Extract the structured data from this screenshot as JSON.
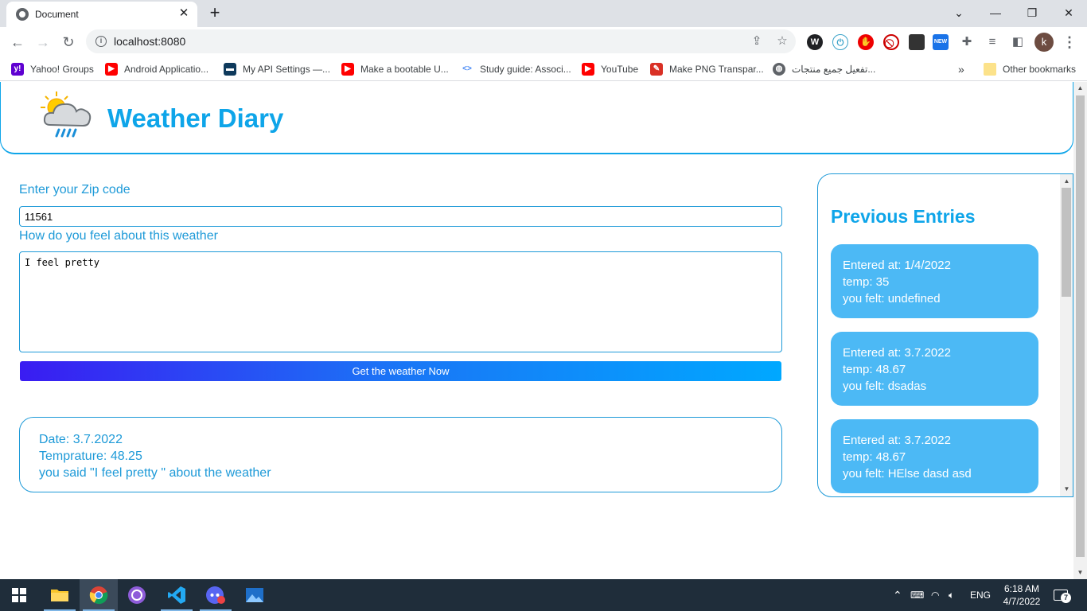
{
  "browser": {
    "tab_title": "Document",
    "tab_close": "✕",
    "new_tab": "+",
    "url": "localhost:8080",
    "window_controls": [
      "⌄",
      "—",
      "❐",
      "✕"
    ],
    "profile_initial": "k",
    "bookmarks": [
      {
        "label": "Yahoo! Groups",
        "icon": "yahoo-icon",
        "color": "#5f01d1"
      },
      {
        "label": "Android Applicatio...",
        "icon": "youtube-icon",
        "color": "#ff0000"
      },
      {
        "label": "My API Settings —...",
        "icon": "api-icon",
        "color": "#0e3a5c"
      },
      {
        "label": "Make a bootable U...",
        "icon": "youtube-icon",
        "color": "#ff0000"
      },
      {
        "label": "Study guide: Associ...",
        "icon": "google-code-icon",
        "color": "#4285f4"
      },
      {
        "label": "YouTube",
        "icon": "youtube-icon",
        "color": "#ff0000"
      },
      {
        "label": "Make PNG Transpar...",
        "icon": "tool-icon",
        "color": "#d93025"
      },
      {
        "label": "تفعيل جميع منتجات...",
        "icon": "globe-icon",
        "color": "#5f6368"
      }
    ],
    "other_bookmarks": "Other bookmarks",
    "more_bookmarks": "»"
  },
  "app": {
    "title": "Weather Diary",
    "zip_label": "Enter your Zip code",
    "zip_value": "11561",
    "feel_label": "How do you feel about this weather",
    "feel_value": "I feel pretty",
    "generate_button": "Get the weather Now",
    "result": {
      "date": "Date: 3.7.2022",
      "temp": "Temprature: 48.25",
      "content": "you said \"I feel pretty \" about the weather"
    }
  },
  "entries": {
    "title": "Previous Entries",
    "items": [
      {
        "date": "Entered at: 1/4/2022",
        "temp": "temp: 35",
        "feel": "you felt: undefined"
      },
      {
        "date": "Entered at: 3.7.2022",
        "temp": "temp: 48.67",
        "feel": "you felt: dsadas"
      },
      {
        "date": "Entered at: 3.7.2022",
        "temp": "temp: 48.67",
        "feel": "you felt: HElse dasd asd"
      }
    ]
  },
  "taskbar": {
    "language": "ENG",
    "time": "6:18 AM",
    "date": "4/7/2022",
    "notifications": "7"
  },
  "colors": {
    "accent": "#0ea5e9",
    "text_blue": "#1e9ad8",
    "card_bg": "#4cb9f5"
  }
}
